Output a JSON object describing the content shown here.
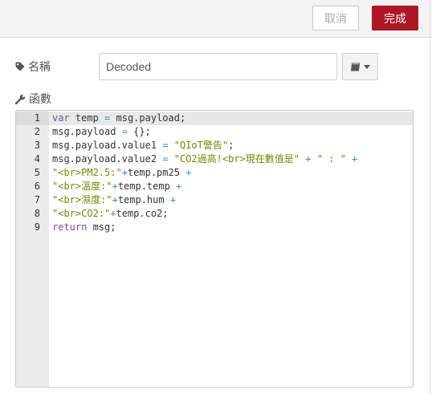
{
  "toolbar": {
    "cancel_label": "取消",
    "done_label": "完成"
  },
  "form": {
    "name_label": "名稱",
    "name_value": "Decoded",
    "func_label": "函數"
  },
  "icons": {
    "name": "tag-icon",
    "func": "wrench-icon",
    "book": "book-icon",
    "dropdown": "caret-down-icon"
  },
  "colors": {
    "done_button": "#ad1625",
    "keyword": "#7a4ca2",
    "string": "#6b8c00",
    "operator": "#3b8bc5"
  },
  "editor": {
    "active_line": 1,
    "lines": [
      {
        "num": "1",
        "tokens": [
          {
            "t": "kw",
            "v": "var"
          },
          {
            "t": "p",
            "v": " temp "
          },
          {
            "t": "op",
            "v": "="
          },
          {
            "t": "p",
            "v": " msg.payload;"
          }
        ]
      },
      {
        "num": "2",
        "tokens": [
          {
            "t": "p",
            "v": "msg.payload "
          },
          {
            "t": "op",
            "v": "="
          },
          {
            "t": "p",
            "v": " {};"
          }
        ]
      },
      {
        "num": "3",
        "tokens": [
          {
            "t": "p",
            "v": "msg.payload.value1 "
          },
          {
            "t": "op",
            "v": "="
          },
          {
            "t": "p",
            "v": " "
          },
          {
            "t": "str",
            "v": "\"QIoT警告\""
          },
          {
            "t": "p",
            "v": ";"
          }
        ]
      },
      {
        "num": "4",
        "tokens": [
          {
            "t": "p",
            "v": "msg.payload.value2 "
          },
          {
            "t": "op",
            "v": "="
          },
          {
            "t": "p",
            "v": " "
          },
          {
            "t": "str",
            "v": "\"CO2過高!<br>現在數值是\""
          },
          {
            "t": "p",
            "v": " "
          },
          {
            "t": "op",
            "v": "+"
          },
          {
            "t": "p",
            "v": " "
          },
          {
            "t": "str",
            "v": "\" : \""
          },
          {
            "t": "p",
            "v": " "
          },
          {
            "t": "op",
            "v": "+"
          }
        ]
      },
      {
        "num": "5",
        "tokens": [
          {
            "t": "str",
            "v": "\"<br>PM2.5:\""
          },
          {
            "t": "op",
            "v": "+"
          },
          {
            "t": "p",
            "v": "temp.pm25 "
          },
          {
            "t": "op",
            "v": "+"
          }
        ]
      },
      {
        "num": "6",
        "tokens": [
          {
            "t": "str",
            "v": "\"<br>溫度:\""
          },
          {
            "t": "op",
            "v": "+"
          },
          {
            "t": "p",
            "v": "temp.temp "
          },
          {
            "t": "op",
            "v": "+"
          }
        ]
      },
      {
        "num": "7",
        "tokens": [
          {
            "t": "str",
            "v": "\"<br>濕度:\""
          },
          {
            "t": "op",
            "v": "+"
          },
          {
            "t": "p",
            "v": "temp.hum "
          },
          {
            "t": "op",
            "v": "+"
          }
        ]
      },
      {
        "num": "8",
        "tokens": [
          {
            "t": "str",
            "v": "\"<br>CO2:\""
          },
          {
            "t": "op",
            "v": "+"
          },
          {
            "t": "p",
            "v": "temp.co2;"
          }
        ]
      },
      {
        "num": "9",
        "tokens": [
          {
            "t": "kw",
            "v": "return"
          },
          {
            "t": "p",
            "v": " msg;"
          }
        ]
      }
    ]
  }
}
